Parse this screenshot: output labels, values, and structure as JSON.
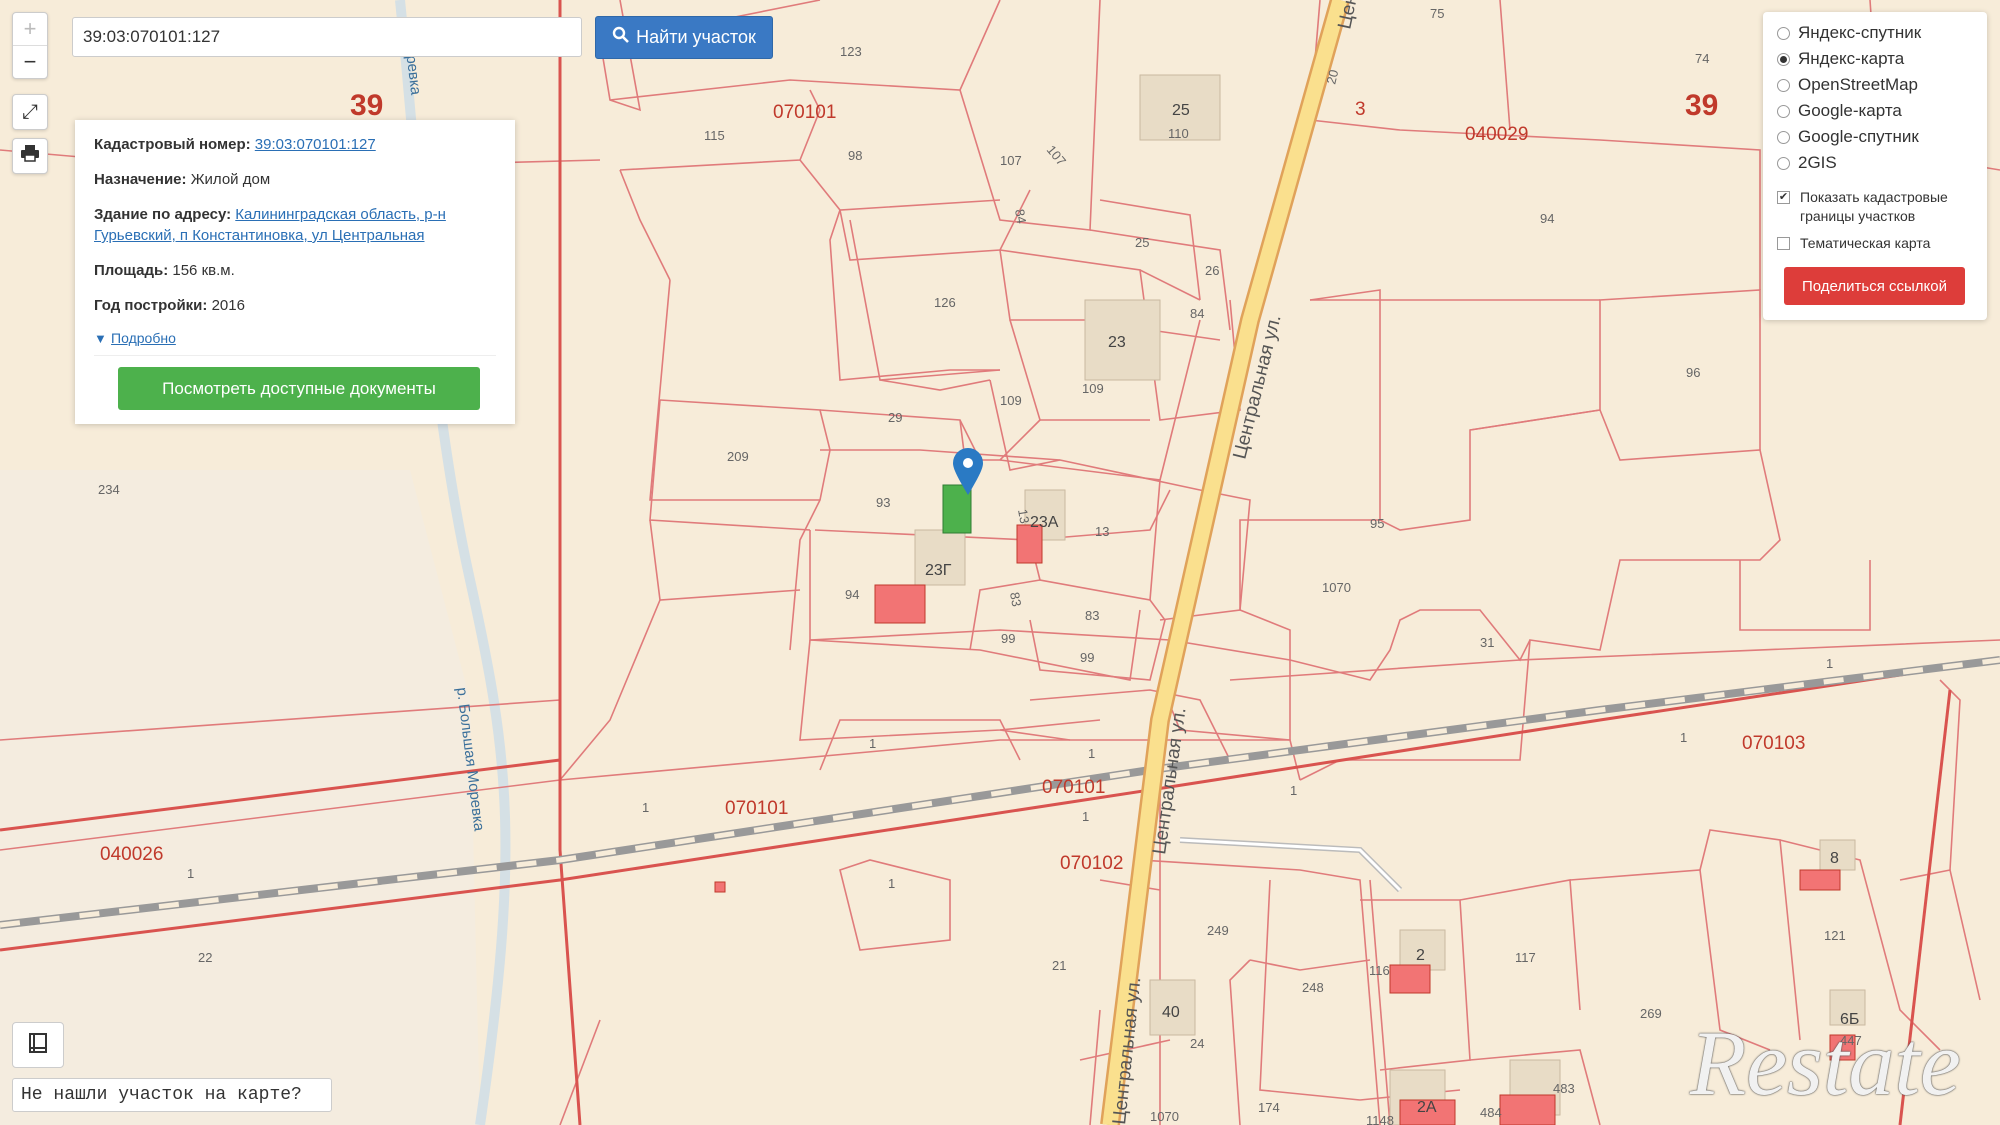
{
  "search": {
    "value": "39:03:070101:127",
    "button_label": "Найти участок"
  },
  "info": {
    "cadastral_label": "Кадастровый номер:",
    "cadastral_value": "39:03:070101:127",
    "purpose_label": "Назначение:",
    "purpose_value": "Жилой дом",
    "address_label": "Здание по адресу:",
    "address_value": "Калининградская область, р-н Гурьевский, п Константиновка, ул Центральная",
    "area_label": "Площадь:",
    "area_value": "156 кв.м.",
    "year_label": "Год постройки:",
    "year_value": "2016",
    "more_label": "Подробно",
    "docs_button": "Посмотреть доступные документы"
  },
  "layers": {
    "options": [
      "Яндекс-спутник",
      "Яндекс-карта",
      "OpenStreetMap",
      "Google-карта",
      "Google-спутник",
      "2GIS"
    ],
    "selected_index": 1,
    "show_borders_label": "Показать кадастровые границы участков",
    "show_borders_checked": true,
    "thematic_label": "Тематическая карта",
    "thematic_checked": false,
    "share_button": "Поделиться ссылкой"
  },
  "not_found": "Не нашли участок на карте?",
  "logo": "Restate",
  "map_labels": {
    "region_left": "39",
    "region_right": "39",
    "region_3": "3",
    "q_070101_top": "070101",
    "q_040029": "040029",
    "q_070101_mid": "070101",
    "q_070101_center": "070101",
    "q_040026": "040026",
    "q_070102": "070102",
    "q_070103": "070103",
    "street_1": "Центральная ул.",
    "street_2": "Центральная ул.",
    "street_3": "Центральная ул.",
    "street_top": "Цен",
    "river": "р. Большая Моревка",
    "river_top": "Моревка",
    "b_25": "25",
    "b_23": "23",
    "b_23a": "23А",
    "b_23g": "23Г",
    "b_40": "40",
    "b_2": "2",
    "b_8": "8",
    "b_6b": "6Б",
    "b_2a": "2А",
    "p_123": "123",
    "p_115": "115",
    "p_98": "98",
    "p_107": "107",
    "p_107b": "107",
    "p_84": "84",
    "p_25": "25",
    "p_26": "26",
    "p_110": "110",
    "p_126": "126",
    "p_84b": "84",
    "p_109": "109",
    "p_109b": "109",
    "p_29": "29",
    "p_209": "209",
    "p_93": "93",
    "p_13": "13",
    "p_13b": "13",
    "p_94": "94",
    "p_83": "83",
    "p_83b": "83",
    "p_99": "99",
    "p_99b": "99",
    "p_234": "234",
    "p_1a": "1",
    "p_1b": "1",
    "p_1c": "1",
    "p_1d": "1",
    "p_1e": "1",
    "p_1f": "1",
    "p_1g": "1",
    "p_1h": "1",
    "p_1i": "1",
    "p_22": "22",
    "p_21": "21",
    "p_249": "249",
    "p_248": "248",
    "p_24": "24",
    "p_116": "116",
    "p_117": "117",
    "p_269": "269",
    "p_121": "121",
    "p_447": "447",
    "p_483": "483",
    "p_1070": "1070",
    "p_1070b": "1070",
    "p_31": "31",
    "p_95": "95",
    "p_96": "96",
    "p_94b": "94",
    "p_75": "75",
    "p_74": "74",
    "p_20": "20",
    "p_484": "484",
    "p_1148": "1148",
    "p_174": "174"
  }
}
